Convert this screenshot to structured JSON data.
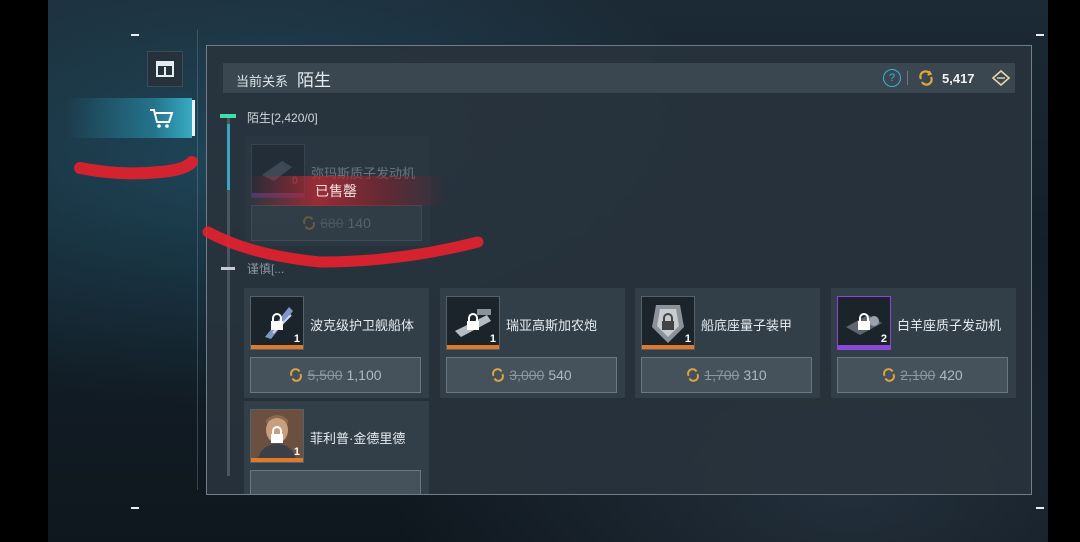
{
  "header": {
    "relation_label": "当前关系",
    "relation_value": "陌生",
    "help_symbol": "?",
    "currency_amount": "5,417",
    "currency_icon": "coin-icon"
  },
  "sections": [
    {
      "label": "陌生[2,420/0]"
    },
    {
      "label": "谨慎[..."
    }
  ],
  "sold_item": {
    "name": "弥玛斯质子发动机",
    "count": "0",
    "old_price": "680",
    "new_price": "140",
    "sold_text": "已售罄"
  },
  "items": [
    {
      "name": "波克级护卫舰船体",
      "count": "1",
      "old_price": "5,500",
      "new_price": "1,100",
      "rarity_color": "#e07a2a"
    },
    {
      "name": "瑞亚高斯加农炮",
      "count": "1",
      "old_price": "3,000",
      "new_price": "540",
      "rarity_color": "#e07a2a"
    },
    {
      "name": "船底座量子装甲",
      "count": "1",
      "old_price": "1,700",
      "new_price": "310",
      "rarity_color": "#e07a2a"
    },
    {
      "name": "白羊座质子发动机",
      "count": "2",
      "old_price": "2,100",
      "new_price": "420",
      "rarity_color": "#8a48d8"
    },
    {
      "name": "菲利普·金德里德",
      "count": "1",
      "rarity_color": "#e07a2a"
    }
  ],
  "colors": {
    "accent": "#3fa4c0",
    "sold": "#be2832",
    "annotation": "#e8202c"
  }
}
